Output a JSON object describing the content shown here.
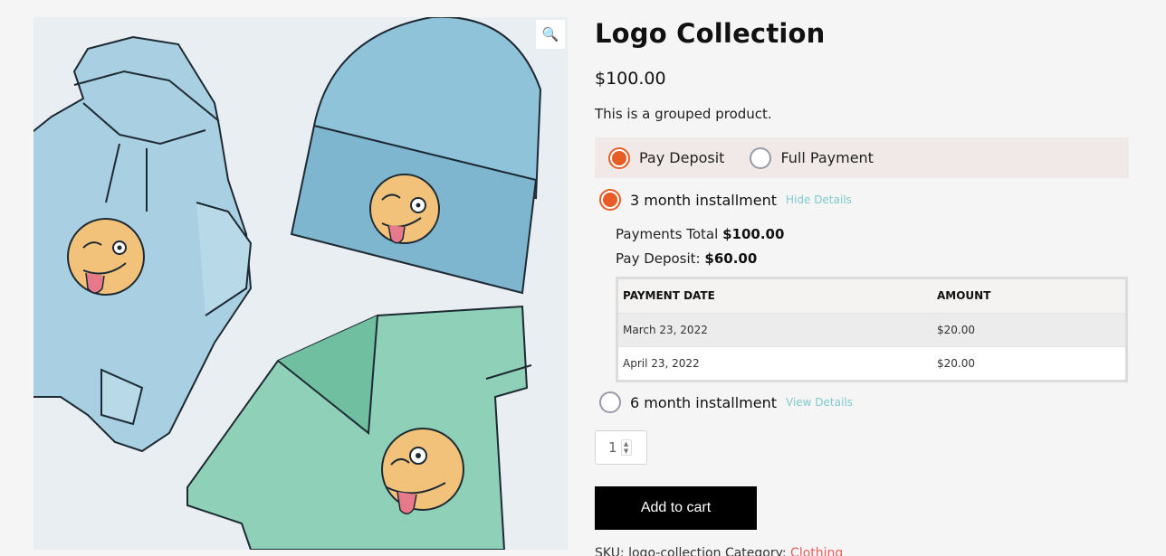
{
  "product": {
    "title": "Logo Collection",
    "price": "$100.00",
    "short_description": "This is a grouped product."
  },
  "gallery": {
    "zoom_icon": "magnifier-icon",
    "zoom_glyph": "🔍"
  },
  "payment_options": {
    "deposit_label": "Pay Deposit",
    "full_label": "Full Payment",
    "selected": "deposit"
  },
  "plans": [
    {
      "label": "3 month installment",
      "toggle_label": "Hide Details",
      "selected": true
    },
    {
      "label": "6 month installment",
      "toggle_label": "View Details",
      "selected": false
    }
  ],
  "plan_details": {
    "payments_total_label": "Payments Total",
    "payments_total_value": "$100.00",
    "pay_deposit_label": "Pay Deposit:",
    "pay_deposit_value": "$60.00",
    "schedule": {
      "headers": [
        "PAYMENT DATE",
        "AMOUNT"
      ],
      "rows": [
        [
          "March 23, 2022",
          "$20.00"
        ],
        [
          "April 23, 2022",
          "$20.00"
        ]
      ]
    }
  },
  "cart": {
    "quantity": "1",
    "add_to_cart_label": "Add to cart"
  },
  "meta": {
    "sku_text": "SKU: logo-collection  Category: ",
    "category": "Clothing"
  },
  "colors": {
    "accent": "#e85d27",
    "link": "#7fc9cf",
    "button_bg": "#000000"
  }
}
